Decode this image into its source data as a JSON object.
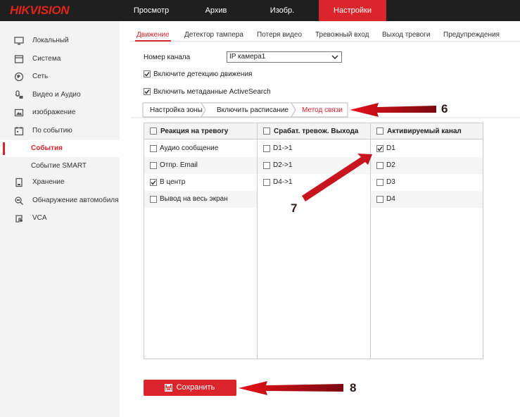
{
  "header": {
    "logo_part1": "HIK",
    "logo_part2": "VISION",
    "nav": [
      "Просмотр",
      "Архив",
      "Изобр.",
      "Настройки"
    ]
  },
  "sidebar": {
    "items": [
      {
        "label": "Локальный",
        "icon": "monitor-icon"
      },
      {
        "label": "Система",
        "icon": "system-window-icon"
      },
      {
        "label": "Сеть",
        "icon": "globe-icon"
      },
      {
        "label": "Видео и Аудио",
        "icon": "mic-camera-icon"
      },
      {
        "label": "изображение",
        "icon": "image-icon"
      },
      {
        "label": "По событию",
        "icon": "calendar-icon"
      },
      {
        "label": "События"
      },
      {
        "label": "Событие SMART"
      },
      {
        "label": "Хранение",
        "icon": "storage-icon"
      },
      {
        "label": "Обнаружение автомобиля",
        "icon": "car-search-icon"
      },
      {
        "label": "VCA",
        "icon": "vca-icon"
      }
    ]
  },
  "tabs": [
    "Движение",
    "Детектор тампера",
    "Потеря видео",
    "Тревожный вход",
    "Выход тревоги",
    "Предупреждения"
  ],
  "channel": {
    "label": "Номер канала",
    "value": "IP камера1"
  },
  "checkboxes": {
    "motion": {
      "label": "Включите детекцию движения",
      "checked": true
    },
    "activesearch": {
      "label": "Включить метаданные ActiveSearch",
      "checked": true
    }
  },
  "subtabs": [
    "Настройка зоны",
    "Включить расписание",
    "Метод связи"
  ],
  "table": {
    "col1": {
      "header": "Реакция на тревогу",
      "rows": [
        {
          "label": "Аудио сообщение",
          "checked": false
        },
        {
          "label": "Отпр. Email",
          "checked": false
        },
        {
          "label": "В центр",
          "checked": true
        },
        {
          "label": "Вывод на весь экран",
          "checked": false
        }
      ]
    },
    "col2": {
      "header": "Срабат. тревож. Выхода",
      "rows": [
        {
          "label": "D1->1",
          "checked": false
        },
        {
          "label": "D2->1",
          "checked": false
        },
        {
          "label": "D4->1",
          "checked": false
        }
      ]
    },
    "col3": {
      "header": "Активируемый канал",
      "rows": [
        {
          "label": "D1",
          "checked": true
        },
        {
          "label": "D2",
          "checked": false
        },
        {
          "label": "D3",
          "checked": false
        },
        {
          "label": "D4",
          "checked": false
        }
      ]
    }
  },
  "save_label": "Сохранить",
  "annotations": [
    "6",
    "7",
    "8"
  ],
  "colors": {
    "accent": "#d9252b",
    "annotation_arrow": "#c8141e"
  }
}
